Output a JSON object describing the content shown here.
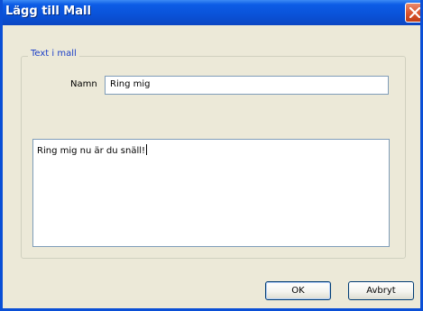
{
  "window": {
    "title": "Lägg till Mall"
  },
  "group": {
    "legend": "Text i mall"
  },
  "name_field": {
    "label": "Namn",
    "value": "Ring mig"
  },
  "message_field": {
    "value": "Ring mig nu är du snäll!"
  },
  "buttons": {
    "ok_label": "OK",
    "cancel_label": "Avbryt"
  },
  "icons": {
    "close": "close-icon"
  },
  "colors": {
    "titlebar": "#0a52d8",
    "close_button": "#d9532c",
    "dialog_background": "#ece9d8",
    "legend_text": "#1c3fc8"
  }
}
